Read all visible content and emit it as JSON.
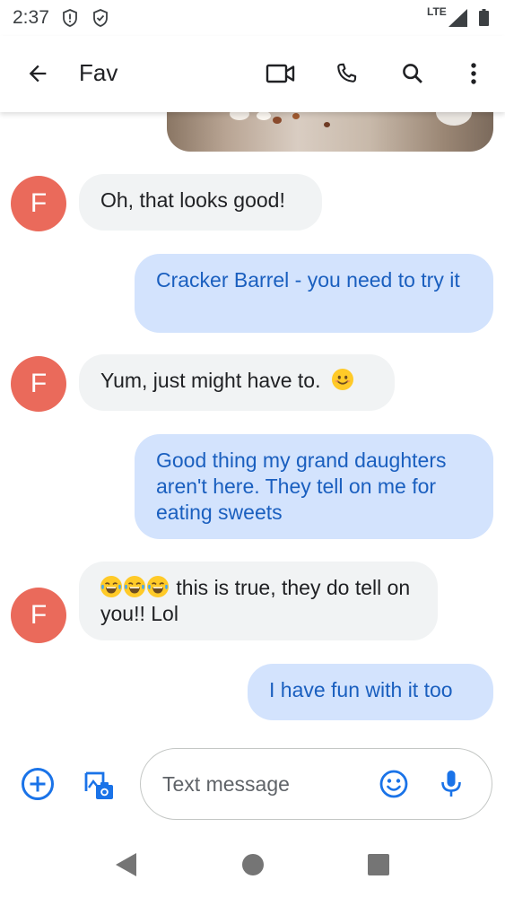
{
  "status_bar": {
    "time": "2:37",
    "network": "LTE",
    "icons": [
      "alert-shield-icon",
      "check-shield-icon",
      "signal-icon",
      "battery-icon"
    ]
  },
  "header": {
    "title": "Fav",
    "icons": [
      "back-arrow-icon",
      "video-call-icon",
      "phone-icon",
      "search-icon",
      "more-vert-icon"
    ]
  },
  "conversation": {
    "contact_initial": "F",
    "colors": {
      "avatar": "#ea6a5b",
      "incoming_bubble": "#f1f3f4",
      "outgoing_bubble": "#d3e3fd",
      "outgoing_text": "#1a5fbf"
    },
    "messages": [
      {
        "direction": "incoming",
        "text": "Oh, that looks good!"
      },
      {
        "direction": "outgoing",
        "text": "Cracker Barrel - you need to try it"
      },
      {
        "direction": "incoming",
        "text": "Yum, just might have to.",
        "trailing_emoji": "smiling-face"
      },
      {
        "direction": "outgoing",
        "text": "Good thing my grand daughters aren't here. They tell on me for eating sweets"
      },
      {
        "direction": "incoming",
        "leading_emoji": [
          "tears-of-joy",
          "tears-of-joy",
          "tears-of-joy"
        ],
        "text": " this is true, they do tell on you!! Lol"
      },
      {
        "direction": "outgoing",
        "text": "I have fun with it too"
      }
    ]
  },
  "compose": {
    "placeholder": "Text message",
    "icons": [
      "add-circle-icon",
      "gallery-icon",
      "emoji-icon",
      "microphone-icon"
    ],
    "accent_color": "#1a73e8"
  },
  "nav_bar": {
    "icons": [
      "nav-back-icon",
      "nav-home-icon",
      "nav-recents-icon"
    ]
  }
}
